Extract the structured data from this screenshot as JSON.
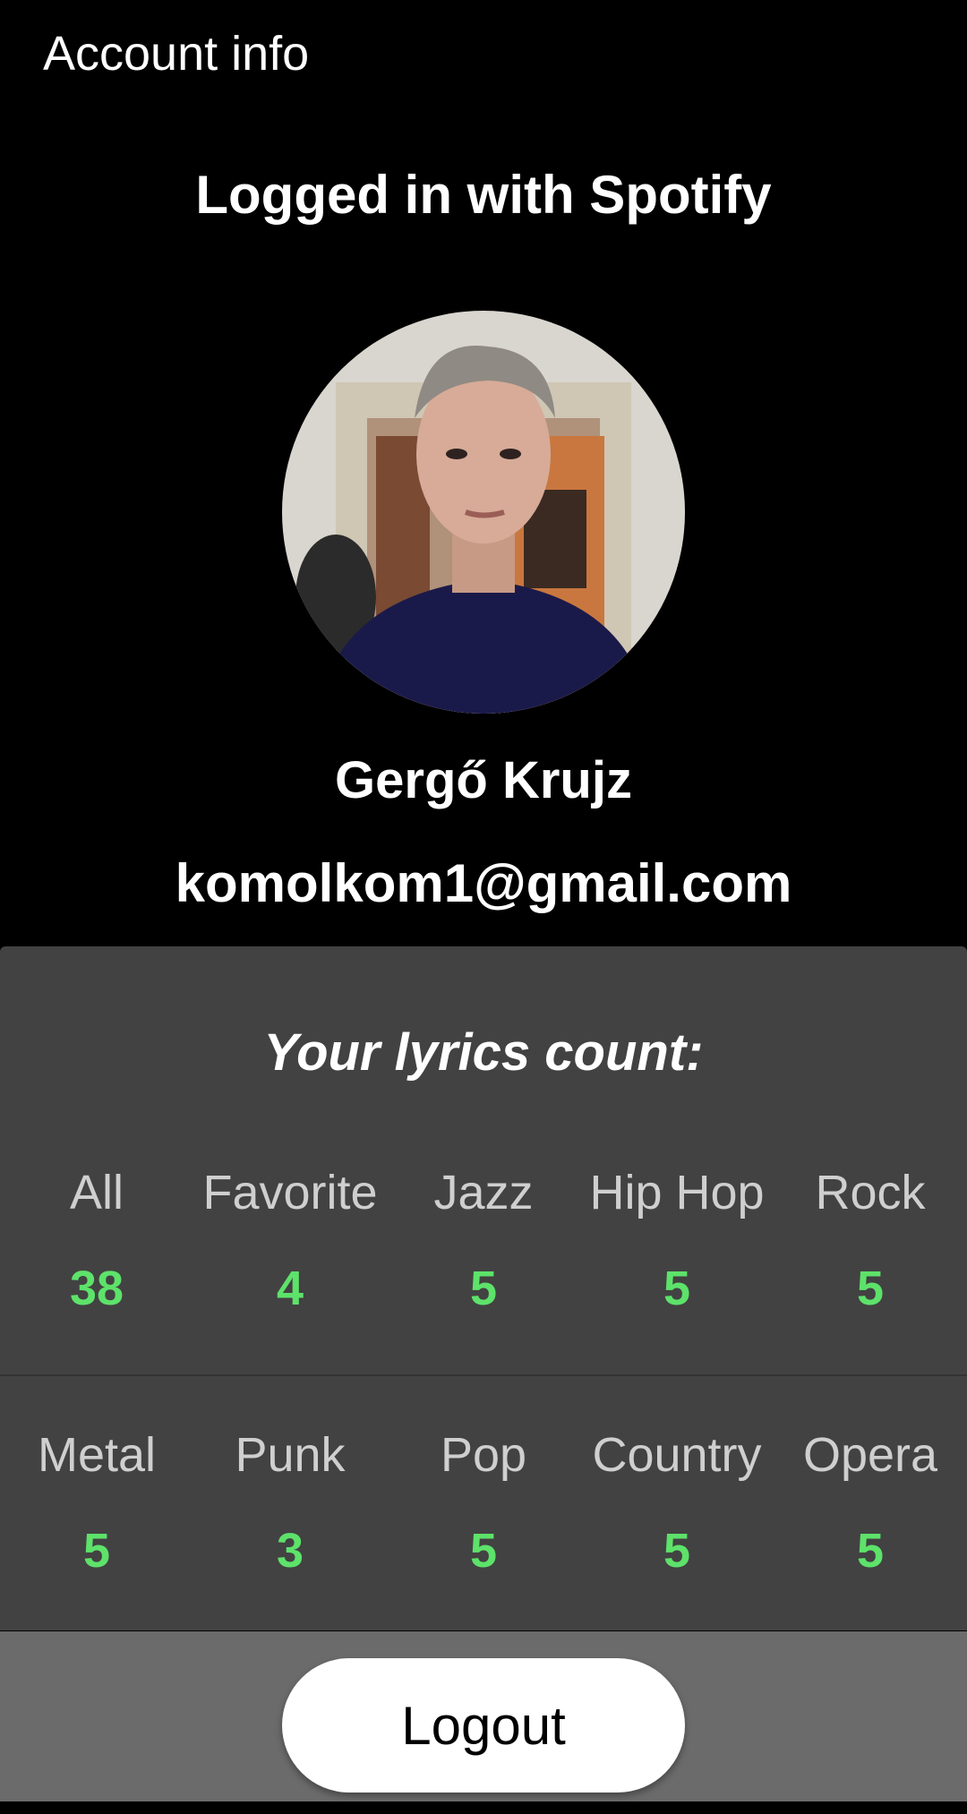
{
  "toolbar": {
    "title": "Account info"
  },
  "login": {
    "status": "Logged in with Spotify"
  },
  "profile": {
    "name": "Gergő Krujz",
    "email": "komolkom1@gmail.com"
  },
  "stats": {
    "title": "Your lyrics count:",
    "row1": [
      {
        "label": "All",
        "count": "38"
      },
      {
        "label": "Favorite",
        "count": "4"
      },
      {
        "label": "Jazz",
        "count": "5"
      },
      {
        "label": "Hip Hop",
        "count": "5"
      },
      {
        "label": "Rock",
        "count": "5"
      }
    ],
    "row2": [
      {
        "label": "Metal",
        "count": "5"
      },
      {
        "label": "Punk",
        "count": "3"
      },
      {
        "label": "Pop",
        "count": "5"
      },
      {
        "label": "Country",
        "count": "5"
      },
      {
        "label": "Opera",
        "count": "5"
      }
    ]
  },
  "actions": {
    "logout_label": "Logout"
  },
  "colors": {
    "background": "#000000",
    "card": "#424242",
    "count_accent": "#5de26a",
    "footer": "#6b6b6b"
  }
}
